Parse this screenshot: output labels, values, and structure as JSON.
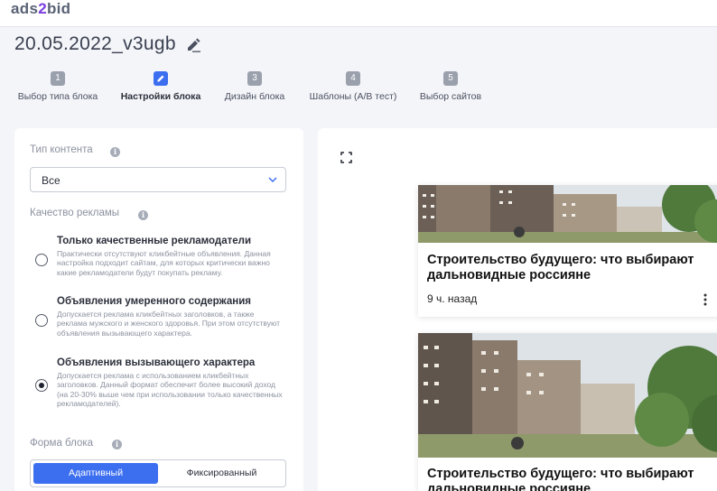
{
  "app": {
    "logo_left": "ads",
    "logo_mid": "2",
    "logo_right": "bid"
  },
  "page": {
    "title": "20.05.2022_v3ugb"
  },
  "steps": [
    {
      "num": "1",
      "label": "Выбор типа блока",
      "active": false
    },
    {
      "num": "",
      "label": "Настройки блока",
      "active": true
    },
    {
      "num": "3",
      "label": "Дизайн блока",
      "active": false
    },
    {
      "num": "4",
      "label": "Шаблоны (A/B тест)",
      "active": false
    },
    {
      "num": "5",
      "label": "Выбор сайтов",
      "active": false
    }
  ],
  "settings": {
    "content_type": {
      "label": "Тип контента",
      "value": "Все"
    },
    "ad_quality": {
      "label": "Качество рекламы",
      "options": [
        {
          "title": "Только качественные рекламодатели",
          "desc": "Практически отсутствуют кликбейтные объявления. Данная настройка подходит сайтам, для которых критически важно какие рекламодатели будут покупать рекламу.",
          "checked": false
        },
        {
          "title": "Объявления умеренного содержания",
          "desc": "Допускается реклама кликбейтных заголовков, а также реклама мужского и женского здоровья. При этом отсутствуют объявления вызывающего характера.",
          "checked": false
        },
        {
          "title": "Объявления вызывающего характера",
          "desc": "Допускается реклама с использованием кликбейтных заголовков. Данный формат обеспечит более высокий доход (на 20-30% выше чем при использовании только качественных рекламодателей).",
          "checked": true
        }
      ]
    },
    "block_form": {
      "label": "Форма блока",
      "options": [
        "Адаптивный",
        "Фиксированный"
      ],
      "selected": "Адаптивный"
    }
  },
  "preview": {
    "cards": [
      {
        "title": "Строительство будущего: что выбирают дальновидные россияне",
        "time": "9 ч. назад"
      },
      {
        "title": "Строительство будущего: что выбирают дальновидные россияне",
        "time": ""
      }
    ]
  },
  "colors": {
    "accent": "#3c6ef0",
    "logo_accent": "#7a3fe0",
    "background": "#f4f5f9"
  }
}
